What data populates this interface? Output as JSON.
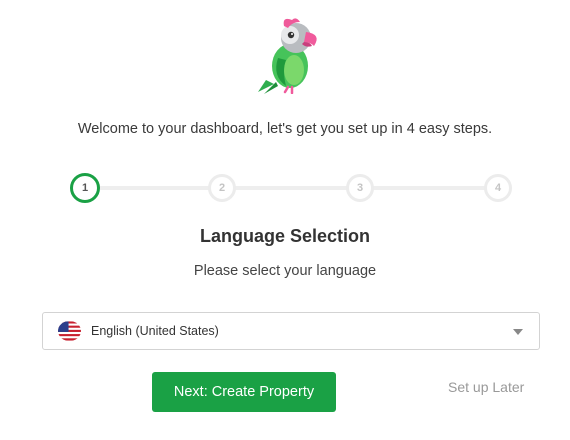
{
  "header": {
    "mascot_icon": "parrot-mascot-icon",
    "welcome_text": "Welcome to your dashboard, let's get you set up in 4 easy steps."
  },
  "stepper": {
    "steps": [
      "1",
      "2",
      "3",
      "4"
    ],
    "active_step": 1,
    "active_color": "#1aa145"
  },
  "section": {
    "title": "Language Selection",
    "subtitle": "Please select your language"
  },
  "language_select": {
    "flag_icon": "us-flag-icon",
    "value": "English (United States)"
  },
  "actions": {
    "next_label": "Next: Create Property",
    "later_label": "Set up Later",
    "primary_color": "#1aa145"
  }
}
